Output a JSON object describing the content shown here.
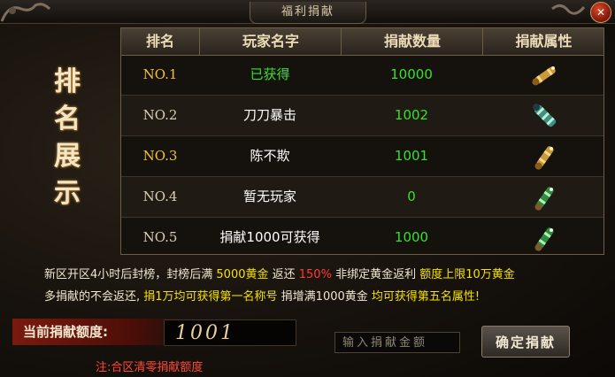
{
  "window": {
    "title": "福利捐献",
    "close_label": "✕"
  },
  "sidebar": {
    "title_chars": [
      "排",
      "名",
      "展",
      "示"
    ]
  },
  "table": {
    "headers": [
      "排名",
      "玩家名字",
      "捐献数量",
      "捐献属性"
    ],
    "rows": [
      {
        "rank": "NO.1",
        "name": "已获得",
        "amount": "10000",
        "item_icon": "gold-scroll-icon"
      },
      {
        "rank": "NO.2",
        "name": "刀刀暴击",
        "amount": "1002",
        "item_icon": "teal-scroll-icon"
      },
      {
        "rank": "NO.3",
        "name": "陈不欺",
        "amount": "1001",
        "item_icon": "gold-scroll-icon"
      },
      {
        "rank": "NO.4",
        "name": "暂无玩家",
        "amount": "0",
        "item_icon": "green-scroll-icon"
      },
      {
        "rank": "NO.5",
        "name": "捐献1000可获得",
        "amount": "1000",
        "item_icon": "green-scroll-icon"
      }
    ]
  },
  "notes": {
    "line1": [
      {
        "text": "新区开区4小时后封榜，封榜后满 ",
        "color": "white"
      },
      {
        "text": "5000黄金",
        "color": "yellow"
      },
      {
        "text": " 返还 ",
        "color": "white"
      },
      {
        "text": "150%",
        "color": "red"
      },
      {
        "text": " 非绑定黄金返利 ",
        "color": "white"
      },
      {
        "text": "额度上限10万黄金",
        "color": "yellow"
      }
    ],
    "line2": [
      {
        "text": "多捐献的不会返还, ",
        "color": "white"
      },
      {
        "text": "捐1万均可获得第一名称号",
        "color": "yellow"
      },
      {
        "text": " 捐增满1000黄金 ",
        "color": "white"
      },
      {
        "text": "均可获得第五名属性!",
        "color": "yellow"
      }
    ]
  },
  "donation": {
    "current_label": "当前捐献额度:",
    "current_value": "1001",
    "input_placeholder": "输入捐献金额",
    "confirm_label": "确定捐献",
    "footnote": "注:合区清零捐献额度"
  },
  "colors": {
    "gold": "#f0c23a",
    "green": "#38e02c",
    "red": "#ff3a3a",
    "yellow": "#f4e100"
  }
}
